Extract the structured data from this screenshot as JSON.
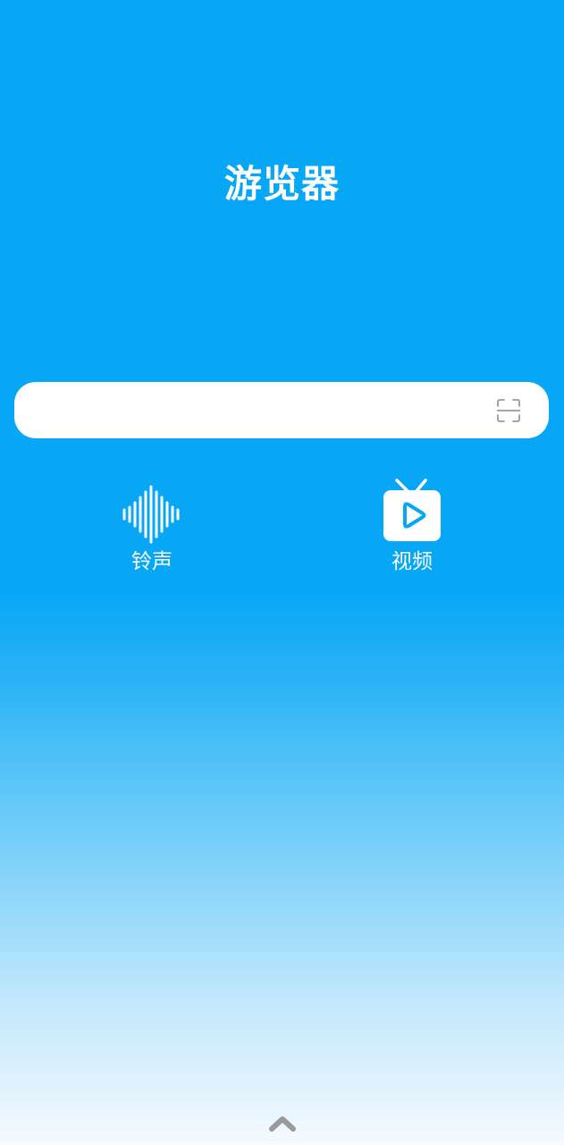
{
  "app": {
    "title": "游览器"
  },
  "search": {
    "value": "",
    "placeholder": "",
    "scan_icon": "scan-icon"
  },
  "shortcuts": [
    {
      "label": "铃声",
      "icon": "sound-wave-icon"
    },
    {
      "label": "视频",
      "icon": "tv-play-icon"
    }
  ],
  "bottom": {
    "icon": "chevron-up-icon"
  },
  "colors": {
    "primary": "#07a7f6",
    "white": "#ffffff",
    "icon_gray": "#9a9a9a"
  }
}
